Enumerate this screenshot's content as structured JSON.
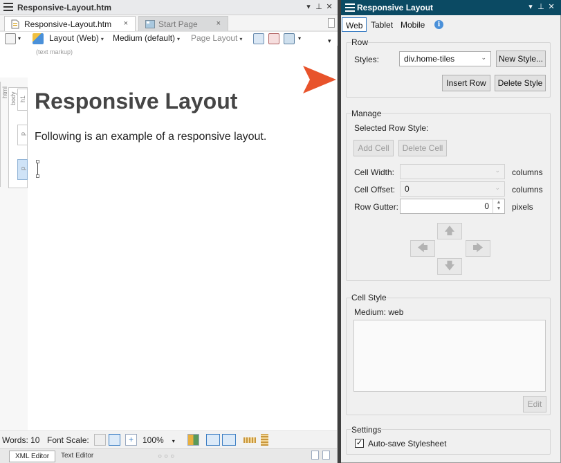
{
  "editor": {
    "window_title": "Responsive-Layout.htm",
    "tabs": [
      {
        "label": "Responsive-Layout.htm",
        "close": "×"
      },
      {
        "label": "Start Page",
        "close": "×"
      }
    ],
    "toolbar": {
      "layout": "Layout (Web)",
      "medium": "Medium (default)",
      "page_layout": "Page Layout"
    },
    "text_markup_hint": "(text markup)",
    "tag_labels": {
      "html": "html",
      "body": "body",
      "h1": "h1",
      "p1": "p",
      "p2": "p"
    },
    "document": {
      "heading": "Responsive Layout",
      "paragraph": "Following is an example of a responsive layout."
    },
    "status": {
      "words_label": "Words: 10",
      "font_scale_label": "Font Scale:",
      "zoom": "100%"
    },
    "bottom_tabs": [
      "XML Editor",
      "Text Editor"
    ],
    "bottom_dots": "○○○"
  },
  "panel": {
    "title": "Responsive Layout",
    "medium_tabs": [
      "Web",
      "Tablet",
      "Mobile"
    ],
    "info_icon": "i",
    "row": {
      "heading": "Row",
      "styles_label": "Styles:",
      "styles_value": "div.home-tiles",
      "new_style": "New Style...",
      "insert_row": "Insert Row",
      "delete_style": "Delete Style"
    },
    "manage": {
      "heading": "Manage",
      "selected_row_style": "Selected Row Style:",
      "add_cell": "Add Cell",
      "delete_cell": "Delete Cell",
      "cell_width_label": "Cell Width:",
      "cell_width_value": "",
      "cell_offset_label": "Cell Offset:",
      "cell_offset_value": "0",
      "row_gutter_label": "Row Gutter:",
      "row_gutter_value": "0",
      "columns_unit": "columns",
      "pixels_unit": "pixels"
    },
    "cell_style": {
      "heading": "Cell Style",
      "medium_label": "Medium: web",
      "edit": "Edit"
    },
    "settings": {
      "heading": "Settings",
      "autosave_label": "Auto-save Stylesheet",
      "autosave_checked": "✓"
    }
  },
  "colors": {
    "panel_title_bg": "#0b4a63",
    "arrow": "#e8532b",
    "heading_text": "#454545",
    "info_blue": "#4a90d9"
  }
}
